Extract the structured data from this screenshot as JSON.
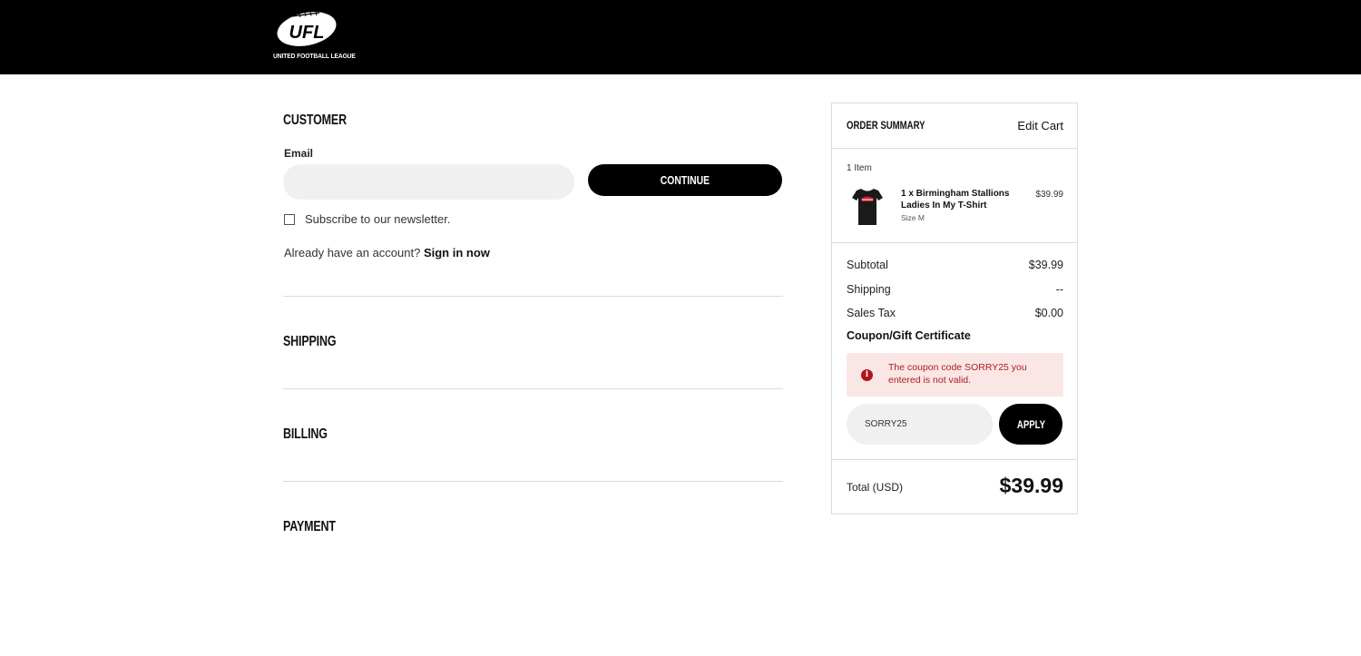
{
  "header": {
    "logo_text": "UFL",
    "logo_subtitle": "UNITED FOOTBALL LEAGUE"
  },
  "customer": {
    "title": "CUSTOMER",
    "email_label": "Email",
    "email_value": "",
    "continue_label": "CONTINUE",
    "subscribe_label": "Subscribe to our newsletter.",
    "subscribe_checked": false,
    "account_prompt": "Already have an account?",
    "sign_in_label": "Sign in now"
  },
  "sections": {
    "shipping": "SHIPPING",
    "billing": "BILLING",
    "payment": "PAYMENT"
  },
  "summary": {
    "title": "ORDER SUMMARY",
    "edit_cart": "Edit Cart",
    "item_count": "1 Item",
    "item": {
      "name": "1 x Birmingham Stallions Ladies In My T-Shirt",
      "size": "Size M",
      "price": "$39.99"
    },
    "subtotal_label": "Subtotal",
    "subtotal_value": "$39.99",
    "shipping_label": "Shipping",
    "shipping_value": "--",
    "tax_label": "Sales Tax",
    "tax_value": "$0.00",
    "coupon_label": "Coupon/Gift Certificate",
    "coupon_error": "The coupon code SORRY25 you entered is not valid.",
    "coupon_value": "SORRY25",
    "apply_label": "APPLY",
    "total_label": "Total (USD)",
    "total_value": "$39.99"
  },
  "colors": {
    "header_bg": "#000000",
    "button_bg": "#000000",
    "error_bg": "#fbe6e6",
    "error_text": "#a8201f"
  },
  "icons": {
    "alert": "info-circle-icon",
    "product": "tshirt-thumbnail"
  }
}
